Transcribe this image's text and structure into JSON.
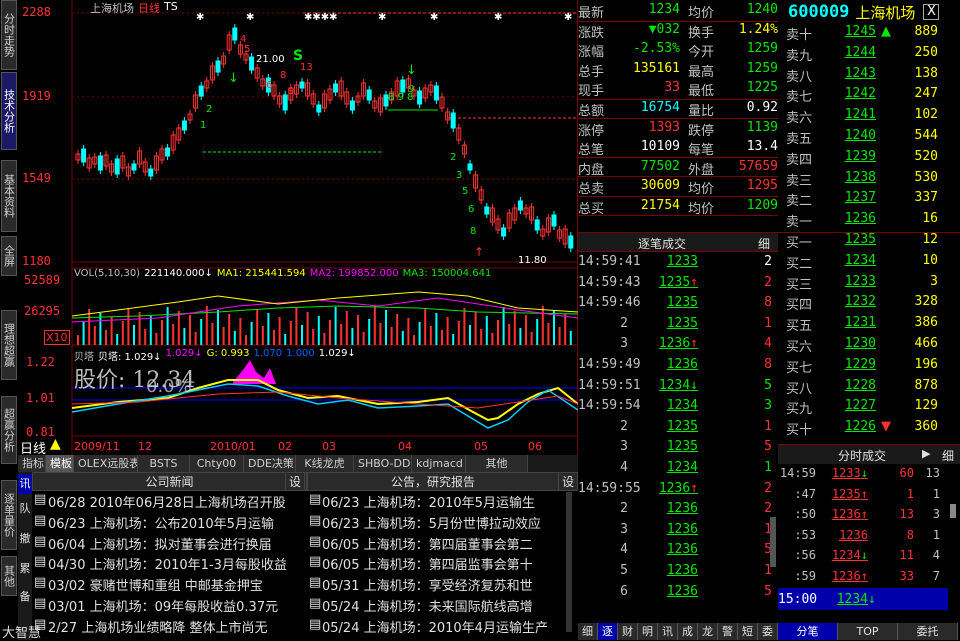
{
  "left_tabs": [
    "分时走势",
    "技术分析",
    "基本资料",
    "全屏",
    "理想超赢",
    "超赢分析",
    "逐单量价",
    "其他"
  ],
  "chart": {
    "title": "上海机场",
    "period": "日线",
    "ts": "TS",
    "price_labels": [
      "2288",
      "1919",
      "1549",
      "1180"
    ],
    "annot_high": "21.00",
    "annot_low": "11.80",
    "vol_header": {
      "name": "VOL(5,10,30)",
      "v": "221140.000↓",
      "ma1": "MA1: 215441.594",
      "ma2": "MA2: 199852.000",
      "ma3": "MA3: 150004.641"
    },
    "vol_labels": [
      "52589",
      "26295",
      "X10"
    ],
    "ind_header": {
      "name": "贝塔",
      "b": "贝塔: 1.029↓",
      "b2": "1.029↓",
      "g": "G: 0.993",
      "h": "1.070",
      "i": "1.000",
      "j": "1.029↓"
    },
    "ind_labels": [
      "1.22",
      "1.01",
      "0.81"
    ],
    "overlay_text": "股价: 12.34",
    "overlay_sub": "0.0%",
    "period_label": "日线",
    "x_labels": [
      "2009/11",
      "12",
      "2010/01",
      "02",
      "03",
      "04",
      "05",
      "06"
    ]
  },
  "quote": {
    "rows": [
      {
        "l1": "最新",
        "v1": "1234",
        "c1": "grn",
        "l2": "均价",
        "v2": "1240",
        "c2": "grn"
      },
      {
        "l1": "涨跌",
        "v1": "▼032",
        "c1": "grn",
        "l2": "换手",
        "v2": "1.24%",
        "c2": "yel"
      },
      {
        "l1": "涨幅",
        "v1": "-2.53%",
        "c1": "grn",
        "l2": "今开",
        "v2": "1259",
        "c2": "grn"
      },
      {
        "l1": "总手",
        "v1": "135161",
        "c1": "yel",
        "l2": "最高",
        "v2": "1259",
        "c2": "grn"
      },
      {
        "l1": "现手",
        "v1": "33",
        "c1": "red",
        "l2": "最低",
        "v2": "1225",
        "c2": "grn"
      },
      {
        "l1": "总额",
        "v1": "16754",
        "c1": "cyn",
        "l2": "量比",
        "v2": "0.92",
        "c2": "wht"
      },
      {
        "l1": "涨停",
        "v1": "1393",
        "c1": "red",
        "l2": "跌停",
        "v2": "1139",
        "c2": "grn"
      },
      {
        "l1": "总笔",
        "v1": "10109",
        "c1": "wht",
        "l2": "每笔",
        "v2": "13.4",
        "c2": "wht"
      },
      {
        "l1": "内盘",
        "v1": "77502",
        "c1": "grn",
        "l2": "外盘",
        "v2": "57659",
        "c2": "red"
      },
      {
        "l1": "总卖",
        "v1": "30609",
        "c1": "yel",
        "l2": "均价",
        "v2": "1295",
        "c2": "red"
      },
      {
        "l1": "总买",
        "v1": "21754",
        "c1": "yel",
        "l2": "均价",
        "v2": "1209",
        "c2": "grn"
      }
    ]
  },
  "ticks": {
    "title": "逐笔成交",
    "btn": "细",
    "rows": [
      {
        "t": "14:59:41",
        "p": "1233",
        "ar": "",
        "v": "2",
        "pc": "grn",
        "vc": "wht"
      },
      {
        "t": "14:59:43",
        "p": "1235",
        "ar": "↑",
        "v": "2",
        "pc": "grn",
        "vc": "red"
      },
      {
        "t": "14:59:46",
        "p": "1235",
        "ar": "",
        "v": "8",
        "pc": "grn",
        "vc": "red"
      },
      {
        "t": "2",
        "p": "1235",
        "ar": "",
        "v": "1",
        "pc": "grn",
        "vc": "red"
      },
      {
        "t": "3",
        "p": "1236",
        "ar": "↑",
        "v": "4",
        "pc": "grn",
        "vc": "red"
      },
      {
        "t": "14:59:49",
        "p": "1236",
        "ar": "",
        "v": "8",
        "pc": "grn",
        "vc": "red"
      },
      {
        "t": "14:59:51",
        "p": "1234",
        "ar": "↓",
        "v": "5",
        "pc": "grn",
        "vc": "grn"
      },
      {
        "t": "14:59:54",
        "p": "1234",
        "ar": "",
        "v": "3",
        "pc": "grn",
        "vc": "grn"
      },
      {
        "t": "2",
        "p": "1235",
        "ar": "",
        "v": "1",
        "pc": "grn",
        "vc": "red"
      },
      {
        "t": "3",
        "p": "1235",
        "ar": "",
        "v": "5",
        "pc": "grn",
        "vc": "red"
      },
      {
        "t": "4",
        "p": "1234",
        "ar": "",
        "v": "1",
        "pc": "grn",
        "vc": "grn"
      },
      {
        "t": "14:59:55",
        "p": "1236",
        "ar": "↑",
        "v": "2",
        "pc": "grn",
        "vc": "red"
      },
      {
        "t": "2",
        "p": "1236",
        "ar": "",
        "v": "2",
        "pc": "grn",
        "vc": "red"
      },
      {
        "t": "3",
        "p": "1236",
        "ar": "",
        "v": "1",
        "pc": "grn",
        "vc": "red"
      },
      {
        "t": "4",
        "p": "1236",
        "ar": "",
        "v": "5",
        "pc": "grn",
        "vc": "red"
      },
      {
        "t": "5",
        "p": "1236",
        "ar": "",
        "v": "1",
        "pc": "grn",
        "vc": "red"
      },
      {
        "t": "6",
        "p": "1236",
        "ar": "",
        "v": "5",
        "pc": "grn",
        "vc": "red"
      }
    ],
    "bottom_tabs": [
      "细",
      "逐",
      "财",
      "明",
      "讯",
      "成",
      "龙",
      "警",
      "短",
      "委"
    ]
  },
  "book": {
    "code": "600009",
    "name": "上海机场",
    "close": "X",
    "sell": [
      {
        "n": "卖十",
        "p": "1245",
        "ar": "▲",
        "v": "889"
      },
      {
        "n": "卖九",
        "p": "1244",
        "ar": "",
        "v": "250"
      },
      {
        "n": "卖八",
        "p": "1243",
        "ar": "",
        "v": "138"
      },
      {
        "n": "卖七",
        "p": "1242",
        "ar": "",
        "v": "247"
      },
      {
        "n": "卖六",
        "p": "1241",
        "ar": "",
        "v": "102"
      },
      {
        "n": "卖五",
        "p": "1240",
        "ar": "",
        "v": "544"
      },
      {
        "n": "卖四",
        "p": "1239",
        "ar": "",
        "v": "520"
      },
      {
        "n": "卖三",
        "p": "1238",
        "ar": "",
        "v": "530"
      },
      {
        "n": "卖二",
        "p": "1237",
        "ar": "",
        "v": "337"
      },
      {
        "n": "卖一",
        "p": "1236",
        "ar": "",
        "v": "16"
      }
    ],
    "buy": [
      {
        "n": "买一",
        "p": "1235",
        "ar": "",
        "v": "12"
      },
      {
        "n": "买二",
        "p": "1234",
        "ar": "",
        "v": "10"
      },
      {
        "n": "买三",
        "p": "1233",
        "ar": "",
        "v": "3"
      },
      {
        "n": "买四",
        "p": "1232",
        "ar": "",
        "v": "328"
      },
      {
        "n": "买五",
        "p": "1231",
        "ar": "",
        "v": "386"
      },
      {
        "n": "买六",
        "p": "1230",
        "ar": "",
        "v": "466"
      },
      {
        "n": "买七",
        "p": "1229",
        "ar": "",
        "v": "196"
      },
      {
        "n": "买八",
        "p": "1228",
        "ar": "",
        "v": "878"
      },
      {
        "n": "买九",
        "p": "1227",
        "ar": "",
        "v": "129"
      },
      {
        "n": "买十",
        "p": "1226",
        "ar": "▼",
        "v": "360"
      }
    ]
  },
  "ftick": {
    "title": "分时成交",
    "rows": [
      {
        "t": "14:59",
        "p": "1233",
        "ar": "↓",
        "v": "60",
        "s": "13",
        "vc": "red"
      },
      {
        "t": ":47",
        "p": "1235",
        "ar": "↑",
        "v": "1",
        "s": "1",
        "vc": "red"
      },
      {
        "t": ":50",
        "p": "1236",
        "ar": "↑",
        "v": "13",
        "s": "3",
        "vc": "red"
      },
      {
        "t": ":53",
        "p": "1236",
        "ar": "",
        "v": "8",
        "s": "1",
        "vc": "red"
      },
      {
        "t": ":56",
        "p": "1234",
        "ar": "↓",
        "v": "11",
        "s": "4",
        "vc": "red"
      },
      {
        "t": ":59",
        "p": "1236",
        "ar": "↑",
        "v": "33",
        "s": "7",
        "vc": "red"
      }
    ],
    "last": {
      "t": "15:00",
      "p": "1234",
      "ar": "↓"
    },
    "tabs": [
      "分笔",
      "TOP",
      "委托"
    ]
  },
  "tabs1": [
    "指标",
    "模板",
    "OLEX远股表",
    "BSTS",
    "Chty00",
    "DDE决策",
    "K线龙虎",
    "SHBO-DDE",
    "kdjmacd",
    "其他"
  ],
  "news": {
    "left_title": "公司新闻",
    "right_title": "公告，研究报告",
    "btn": "设",
    "side_tabs": [
      "讯",
      "队",
      "撤",
      "累",
      "备"
    ],
    "left": [
      "06/28 2010年06月28日上海机场召开股",
      "06/23 上海机场：公布2010年5月运输",
      "06/04 上海机场：拟对董事会进行换届",
      "04/30 上海机场：2010年1-3月每股收益",
      "03/02 豪赌世博和重组 中邮基金押宝",
      "03/01 上海机场：09年每股收益0.37元",
      "2/27 上海机场业绩略降 整体上市尚无"
    ],
    "right": [
      "06/23 上海机场：2010年5月运输生",
      "06/23 上海机场：5月份世博拉动效应",
      "06/05 上海机场：第四届董事会第二",
      "06/05 上海机场：第四届监事会第十",
      "05/31 上海机场：享受经济复苏和世",
      "05/24 上海机场：未来国际航线高增",
      "05/24 上海机场：2010年4月运输生产"
    ],
    "bottom_left": "大智慧"
  }
}
